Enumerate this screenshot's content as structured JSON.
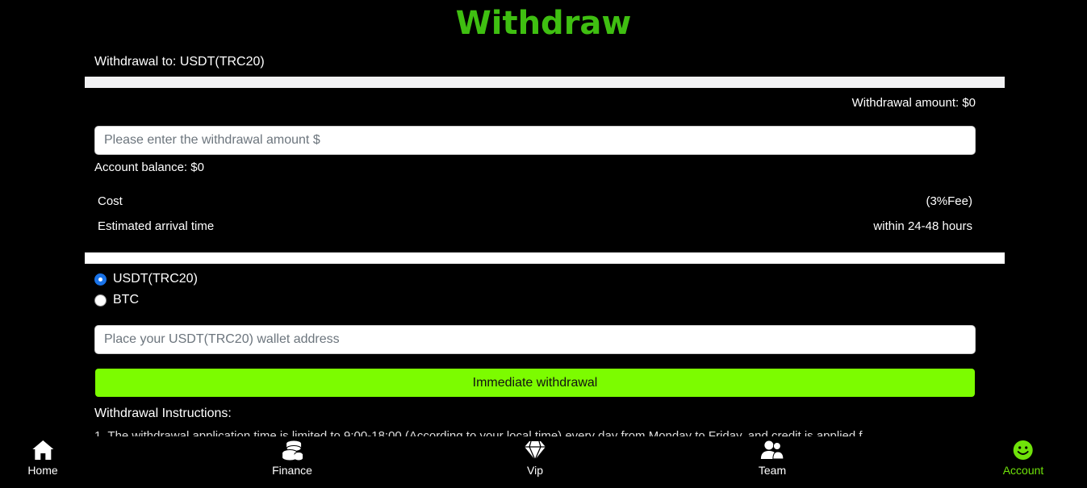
{
  "header": {
    "title": "Withdraw"
  },
  "withdrawal_to": "Withdrawal to: USDT(TRC20)",
  "amount_label": "Withdrawal amount: $0",
  "amount_input": {
    "placeholder": "Please enter the withdrawal amount $",
    "value": ""
  },
  "account_balance": "Account balance: $0",
  "details": [
    {
      "label": "Cost",
      "value": "(3%Fee)"
    },
    {
      "label": "Estimated arrival time",
      "value": "within 24-48 hours"
    }
  ],
  "methods": [
    {
      "label": "USDT(TRC20)",
      "checked": true
    },
    {
      "label": "BTC",
      "checked": false
    }
  ],
  "wallet_input": {
    "placeholder": "Place your USDT(TRC20) wallet address",
    "value": ""
  },
  "submit_label": "Immediate withdrawal",
  "instructions": {
    "title": "Withdrawal Instructions:",
    "first_line": "1. The withdrawal application time is limited to 9:00-18:00 (According to your local time) every day from Monday to Friday, and credit is applied f"
  },
  "nav": {
    "items": [
      {
        "label": "Home",
        "icon": "home-icon"
      },
      {
        "label": "Finance",
        "icon": "coins-icon"
      },
      {
        "label": "Vip",
        "icon": "diamond-icon"
      },
      {
        "label": "Team",
        "icon": "users-icon"
      },
      {
        "label": "Account",
        "icon": "smile-icon",
        "active": true
      }
    ]
  },
  "colors": {
    "title_green": "#3fbf11",
    "button_green": "#7cfc00",
    "active_nav": "#6fe20a",
    "radio_checked": "#1a73e8"
  }
}
